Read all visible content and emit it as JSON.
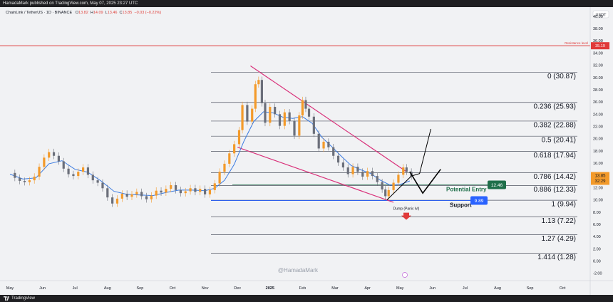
{
  "publisher_line": "HamadaMark published on TradingView.com, May 07, 2025 23:27 UTC",
  "symbol": {
    "name": "ChainLink / TetherUS · 1D · BINANCE",
    "o_label": "O",
    "o": "13.82",
    "h_label": "H",
    "h": "14.09",
    "l_label": "L",
    "l": "13.46",
    "c_label": "C",
    "c": "13.85",
    "change": "−0.03 (−0.22%)"
  },
  "footer": {
    "brand": "TradingView"
  },
  "watermark": "@HamadaMark",
  "colors": {
    "background": "#f1f2f4",
    "up": "#f39a2a",
    "down": "#6b6f7a",
    "ma": "#3b7be0",
    "channel": "#d9317a",
    "resistance": "#e03a3a",
    "fib": "#505462",
    "entry": "#1f6f4a",
    "support": "#2962ff"
  },
  "chart_data": {
    "type": "candlestick",
    "title": "",
    "currency_label": "USDT",
    "x_ticks": [
      "May",
      "Jun",
      "Jul",
      "Aug",
      "Sep",
      "Oct",
      "Nov",
      "Dec",
      "2025",
      "Feb",
      "Mar",
      "Apr",
      "May",
      "Jun",
      "Jul",
      "Aug",
      "Sep",
      "Oct"
    ],
    "y_ticks": [
      "40.00",
      "38.00",
      "36.00",
      "34.00",
      "32.00",
      "30.00",
      "28.00",
      "26.00",
      "24.00",
      "22.00",
      "20.00",
      "18.00",
      "16.00",
      "14.00",
      "12.00",
      "10.00",
      "8.00",
      "6.00",
      "4.00",
      "2.00",
      "0.00",
      "-2.00"
    ],
    "ylim": [
      -3.2,
      41.5
    ],
    "resistance": {
      "label": "Resistance level",
      "value": 35.19,
      "tag": "35.19"
    },
    "price_tag": {
      "value": "13.85",
      "countdown": "32:29"
    },
    "fib_levels": [
      {
        "label": "0 (30.87)",
        "value": 30.87
      },
      {
        "label": "0.236 (25.93)",
        "value": 25.93
      },
      {
        "label": "0.382 (22.88)",
        "value": 22.88
      },
      {
        "label": "0.5 (20.41)",
        "value": 20.41
      },
      {
        "label": "0.618 (17.94)",
        "value": 17.94
      },
      {
        "label": "0.786 (14.42)",
        "value": 14.42
      },
      {
        "label": "0.886 (12.33)",
        "value": 12.33
      },
      {
        "label": "1 (9.94)",
        "value": 9.94
      },
      {
        "label": "1.13 (7.22)",
        "value": 7.22
      },
      {
        "label": "1.27 (4.29)",
        "value": 4.29
      },
      {
        "label": "1.414 (1.28)",
        "value": 1.28
      }
    ],
    "potential_entry": {
      "label": "Potential Entry",
      "value": 12.46,
      "tag": "12.46"
    },
    "support": {
      "label": "Support",
      "value": 9.89,
      "tag": "9.89"
    },
    "dump": {
      "label": "Dump (Panic lvl)",
      "value": 7.2
    },
    "channel": {
      "upper_start": {
        "date_index": 7.4,
        "value": 31.9
      },
      "upper_end": {
        "date_index": 12.2,
        "value": 14.6
      },
      "lower_start": {
        "date_index": 7.0,
        "value": 18.6
      },
      "lower_end": {
        "date_index": 11.8,
        "value": 9.6
      }
    },
    "close_series": [
      {
        "t": 0.0,
        "v": 14.4
      },
      {
        "t": 0.15,
        "v": 13.6
      },
      {
        "t": 0.3,
        "v": 13.1
      },
      {
        "t": 0.45,
        "v": 12.9
      },
      {
        "t": 0.6,
        "v": 13.2
      },
      {
        "t": 0.75,
        "v": 13.8
      },
      {
        "t": 0.9,
        "v": 15.4
      },
      {
        "t": 1.05,
        "v": 16.9
      },
      {
        "t": 1.2,
        "v": 17.8
      },
      {
        "t": 1.35,
        "v": 17.2
      },
      {
        "t": 1.5,
        "v": 16.3
      },
      {
        "t": 1.65,
        "v": 15.1
      },
      {
        "t": 1.8,
        "v": 14.2
      },
      {
        "t": 1.95,
        "v": 13.9
      },
      {
        "t": 2.1,
        "v": 14.6
      },
      {
        "t": 2.25,
        "v": 15.3
      },
      {
        "t": 2.4,
        "v": 14.1
      },
      {
        "t": 2.55,
        "v": 13.2
      },
      {
        "t": 2.7,
        "v": 12.8
      },
      {
        "t": 2.85,
        "v": 11.9
      },
      {
        "t": 3.0,
        "v": 10.4
      },
      {
        "t": 3.15,
        "v": 9.4
      },
      {
        "t": 3.3,
        "v": 10.2
      },
      {
        "t": 3.45,
        "v": 11.0
      },
      {
        "t": 3.6,
        "v": 10.5
      },
      {
        "t": 3.75,
        "v": 10.9
      },
      {
        "t": 3.9,
        "v": 11.3
      },
      {
        "t": 4.05,
        "v": 10.6
      },
      {
        "t": 4.2,
        "v": 10.1
      },
      {
        "t": 4.35,
        "v": 10.7
      },
      {
        "t": 4.5,
        "v": 11.5
      },
      {
        "t": 4.65,
        "v": 11.2
      },
      {
        "t": 4.8,
        "v": 11.8
      },
      {
        "t": 4.95,
        "v": 12.4
      },
      {
        "t": 5.1,
        "v": 11.6
      },
      {
        "t": 5.25,
        "v": 11.1
      },
      {
        "t": 5.4,
        "v": 11.4
      },
      {
        "t": 5.55,
        "v": 11.9
      },
      {
        "t": 5.7,
        "v": 11.3
      },
      {
        "t": 5.85,
        "v": 11.8
      },
      {
        "t": 6.0,
        "v": 10.9
      },
      {
        "t": 6.15,
        "v": 11.6
      },
      {
        "t": 6.3,
        "v": 12.7
      },
      {
        "t": 6.45,
        "v": 14.6
      },
      {
        "t": 6.6,
        "v": 15.9
      },
      {
        "t": 6.75,
        "v": 17.6
      },
      {
        "t": 6.9,
        "v": 19.1
      },
      {
        "t": 7.05,
        "v": 21.4
      },
      {
        "t": 7.15,
        "v": 25.5
      },
      {
        "t": 7.3,
        "v": 22.8
      },
      {
        "t": 7.45,
        "v": 24.9
      },
      {
        "t": 7.55,
        "v": 28.9
      },
      {
        "t": 7.65,
        "v": 29.6
      },
      {
        "t": 7.75,
        "v": 25.8
      },
      {
        "t": 7.85,
        "v": 22.6
      },
      {
        "t": 8.0,
        "v": 25.2
      },
      {
        "t": 8.15,
        "v": 24.0
      },
      {
        "t": 8.3,
        "v": 22.1
      },
      {
        "t": 8.45,
        "v": 24.3
      },
      {
        "t": 8.6,
        "v": 22.9
      },
      {
        "t": 8.75,
        "v": 20.5
      },
      {
        "t": 8.9,
        "v": 23.8
      },
      {
        "t": 9.0,
        "v": 26.3
      },
      {
        "t": 9.1,
        "v": 24.9
      },
      {
        "t": 9.2,
        "v": 23.6
      },
      {
        "t": 9.35,
        "v": 20.8
      },
      {
        "t": 9.5,
        "v": 18.4
      },
      {
        "t": 9.65,
        "v": 19.5
      },
      {
        "t": 9.8,
        "v": 18.6
      },
      {
        "t": 9.95,
        "v": 17.2
      },
      {
        "t": 10.1,
        "v": 16.1
      },
      {
        "t": 10.25,
        "v": 15.3
      },
      {
        "t": 10.4,
        "v": 14.2
      },
      {
        "t": 10.55,
        "v": 15.4
      },
      {
        "t": 10.7,
        "v": 14.6
      },
      {
        "t": 10.85,
        "v": 13.8
      },
      {
        "t": 11.0,
        "v": 14.7
      },
      {
        "t": 11.15,
        "v": 13.9
      },
      {
        "t": 11.3,
        "v": 12.9
      },
      {
        "t": 11.45,
        "v": 11.7
      },
      {
        "t": 11.55,
        "v": 10.6
      },
      {
        "t": 11.65,
        "v": 11.6
      },
      {
        "t": 11.8,
        "v": 12.8
      },
      {
        "t": 11.95,
        "v": 14.1
      },
      {
        "t": 12.1,
        "v": 15.3
      },
      {
        "t": 12.2,
        "v": 14.6
      },
      {
        "t": 12.35,
        "v": 13.85
      }
    ],
    "ma_series": [
      {
        "t": 0.0,
        "v": 14.2
      },
      {
        "t": 0.4,
        "v": 13.4
      },
      {
        "t": 0.8,
        "v": 13.6
      },
      {
        "t": 1.2,
        "v": 15.9
      },
      {
        "t": 1.6,
        "v": 16.4
      },
      {
        "t": 2.0,
        "v": 15.0
      },
      {
        "t": 2.4,
        "v": 14.5
      },
      {
        "t": 2.8,
        "v": 13.1
      },
      {
        "t": 3.2,
        "v": 11.4
      },
      {
        "t": 3.6,
        "v": 10.9
      },
      {
        "t": 4.0,
        "v": 10.8
      },
      {
        "t": 4.4,
        "v": 10.7
      },
      {
        "t": 4.8,
        "v": 11.2
      },
      {
        "t": 5.2,
        "v": 11.6
      },
      {
        "t": 5.6,
        "v": 11.6
      },
      {
        "t": 6.0,
        "v": 11.5
      },
      {
        "t": 6.3,
        "v": 11.9
      },
      {
        "t": 6.6,
        "v": 13.2
      },
      {
        "t": 6.9,
        "v": 15.8
      },
      {
        "t": 7.2,
        "v": 19.6
      },
      {
        "t": 7.5,
        "v": 22.8
      },
      {
        "t": 7.8,
        "v": 24.4
      },
      {
        "t": 8.1,
        "v": 24.2
      },
      {
        "t": 8.4,
        "v": 23.5
      },
      {
        "t": 8.7,
        "v": 23.3
      },
      {
        "t": 9.0,
        "v": 23.6
      },
      {
        "t": 9.3,
        "v": 22.5
      },
      {
        "t": 9.6,
        "v": 20.2
      },
      {
        "t": 9.9,
        "v": 18.7
      },
      {
        "t": 10.2,
        "v": 17.1
      },
      {
        "t": 10.5,
        "v": 15.6
      },
      {
        "t": 10.8,
        "v": 14.9
      },
      {
        "t": 11.1,
        "v": 14.3
      },
      {
        "t": 11.4,
        "v": 13.2
      },
      {
        "t": 11.7,
        "v": 12.4
      },
      {
        "t": 12.0,
        "v": 12.5
      },
      {
        "t": 12.3,
        "v": 13.1
      }
    ],
    "projection_paths": [
      [
        {
          "t": 11.6,
          "v": 10.0
        },
        {
          "t": 12.35,
          "v": 13.9
        },
        {
          "t": 12.6,
          "v": 14.3
        },
        {
          "t": 12.95,
          "v": 21.6
        }
      ],
      [
        {
          "t": 12.3,
          "v": 14.6
        },
        {
          "t": 12.7,
          "v": 11.1
        },
        {
          "t": 13.25,
          "v": 15.0
        }
      ]
    ]
  }
}
